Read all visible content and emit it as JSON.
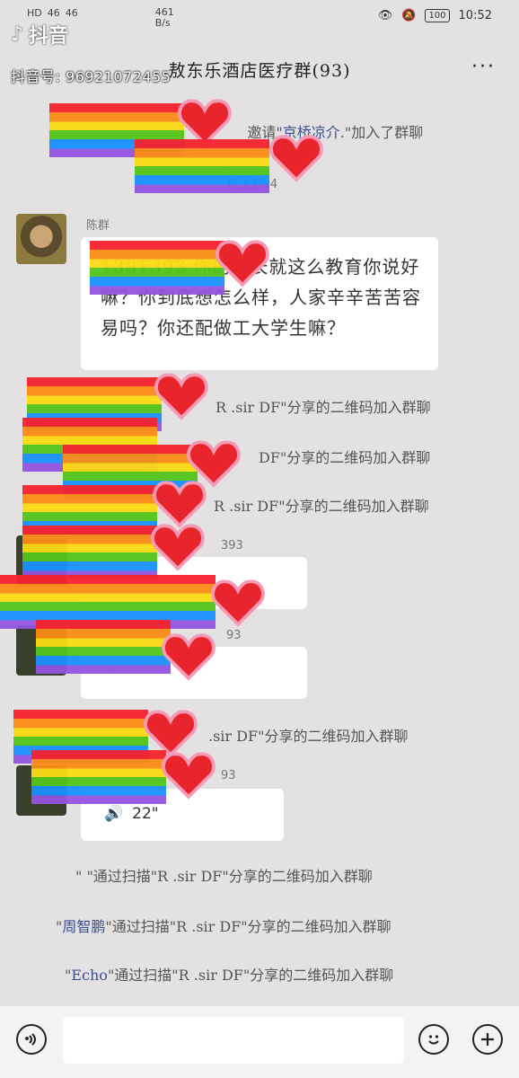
{
  "status_bar": {
    "network_left": "HD",
    "signal1": "46",
    "signal2": "46",
    "speed_value": "461",
    "speed_unit": "B/s",
    "battery": "100",
    "time": "10:52"
  },
  "watermark": {
    "app_name": "抖音",
    "id_text": "抖音号: 96921072455"
  },
  "header": {
    "title": "敖东乐酒店医疗群(93)",
    "more": "···"
  },
  "messages": {
    "sys_invite": {
      "prefix": "\"",
      "mid": "邀请\"",
      "name": "京桥凉介",
      "suffix": ".\"加入了群聊"
    },
    "time_stamp": "晚上10:4",
    "sender_name": "陈群",
    "bubble_text": "1381393 你的家长就这么教育你说好嘛？你到底想怎么样，人家辛辛苦苦容易吗？你还配做工大学生嘛？",
    "sys_1": "R .sir DF\"分享的二维码加入群聊",
    "sys_2": "DF\"分享的二维码加入群聊",
    "sys_3": "R .sir DF\"分享的二维码加入群聊",
    "partial_1": "393",
    "partial_2": "93",
    "sys_4": ".sir DF\"分享的二维码加入群聊",
    "partial_3": "93",
    "voice_duration": "22\"",
    "sys_5": "\"  \"通过扫描\"R .sir DF\"分享的二维码加入群聊",
    "sys_6_name": "周智鹏",
    "sys_6": "\"通过扫描\"R .sir DF\"分享的二维码加入群聊",
    "sys_7_name": "Echo",
    "sys_7": "\"通过扫描\"R .sir DF\"分享的二维码加入群聊"
  },
  "input_bar": {
    "voice_icon": "voice-icon",
    "emoji_icon": "emoji-icon",
    "plus_icon": "plus-icon"
  }
}
